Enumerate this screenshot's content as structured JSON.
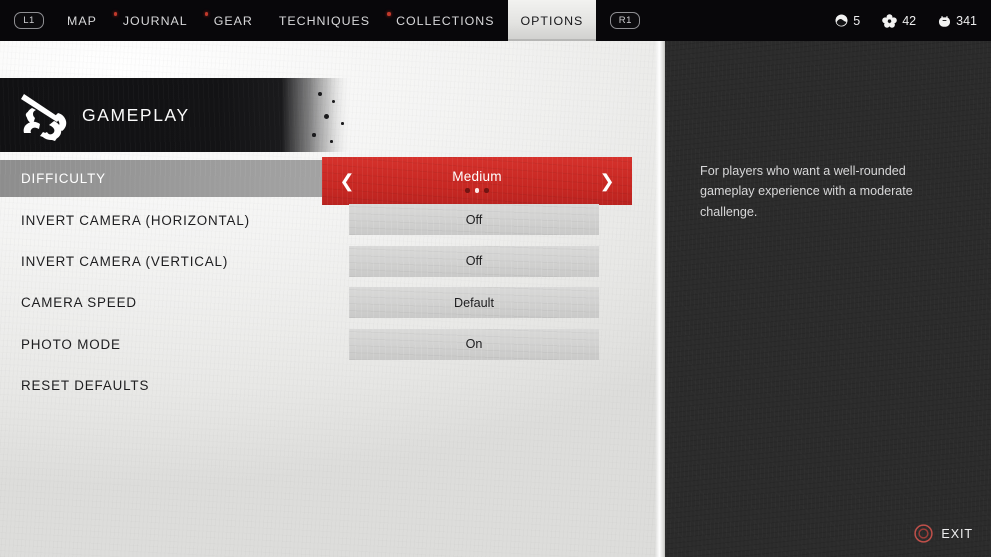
{
  "topbar": {
    "left_bumper": "L1",
    "right_bumper": "R1",
    "tabs": [
      {
        "label": "MAP",
        "active": false,
        "dot": false
      },
      {
        "label": "JOURNAL",
        "active": false,
        "dot": true
      },
      {
        "label": "GEAR",
        "active": false,
        "dot": true
      },
      {
        "label": "TECHNIQUES",
        "active": false,
        "dot": false
      },
      {
        "label": "COLLECTIONS",
        "active": false,
        "dot": true
      },
      {
        "label": "OPTIONS",
        "active": true,
        "dot": false
      }
    ],
    "resources": [
      {
        "icon": "charm-stone-icon",
        "value": "5"
      },
      {
        "icon": "flower-icon",
        "value": "42"
      },
      {
        "icon": "supplies-pouch-icon",
        "value": "341"
      }
    ]
  },
  "header": {
    "icon": "samurai-emblem-icon",
    "title": "GAMEPLAY"
  },
  "options": [
    {
      "label": "DIFFICULTY",
      "value": "Medium",
      "selected": true,
      "dots": {
        "count": 3,
        "active_index": 1
      },
      "left_arrow": "❮",
      "right_arrow": "❯"
    },
    {
      "label": "INVERT CAMERA (HORIZONTAL)",
      "value": "Off",
      "selected": false
    },
    {
      "label": "INVERT CAMERA (VERTICAL)",
      "value": "Off",
      "selected": false
    },
    {
      "label": "CAMERA SPEED",
      "value": "Default",
      "selected": false
    },
    {
      "label": "PHOTO MODE",
      "value": "On",
      "selected": false
    },
    {
      "label": "RESET DEFAULTS",
      "value": "",
      "selected": false
    }
  ],
  "detail": {
    "description": "For players who want a well-rounded gameplay experience with a moderate challenge."
  },
  "footer": {
    "exit_label": "EXIT",
    "exit_button_icon": "circle-button-icon"
  },
  "colors": {
    "accent_red": "#c62722",
    "paper": "#f1f1ef",
    "panel_dark": "#2b2b2b",
    "nav_black": "#08070a",
    "highlight_gray": "#9c9c9c"
  }
}
